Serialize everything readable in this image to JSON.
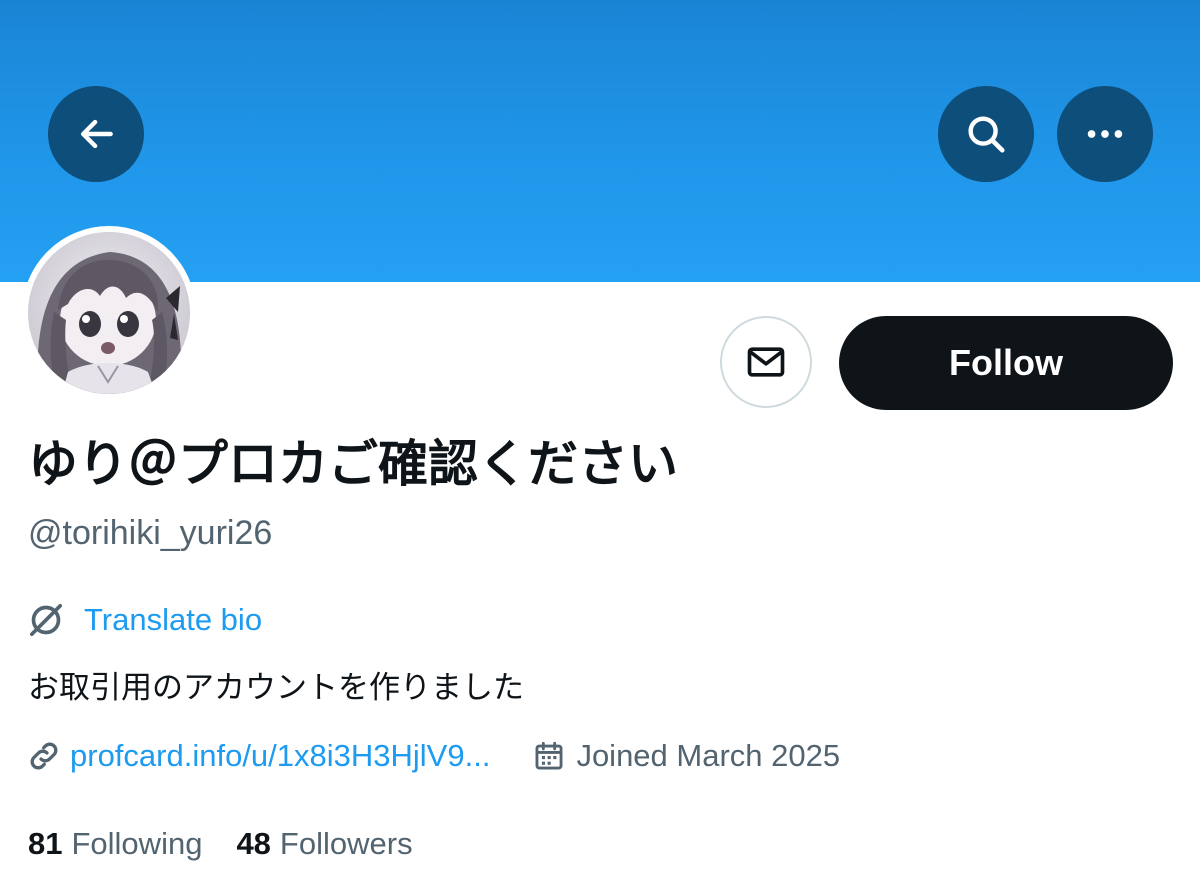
{
  "header": {
    "back_icon": "arrow-left-icon",
    "search_icon": "search-icon",
    "more_icon": "more-horizontal-icon",
    "banner_color": "#1d9bf0",
    "button_color": "#0e4e7a"
  },
  "profile": {
    "display_name": "ゆり＠プロカご確認ください",
    "handle": "@torihiki_yuri26",
    "translate_label": "Translate bio",
    "bio": "お取引用のアカウントを作りました",
    "link": "profcard.info/u/1x8i3H3HjlV9...",
    "joined": "Joined March 2025"
  },
  "actions": {
    "message_icon": "envelope-icon",
    "follow_label": "Follow"
  },
  "stats": {
    "following_count": "81",
    "following_label": "Following",
    "followers_count": "48",
    "followers_label": "Followers"
  },
  "colors": {
    "link": "#1d9bf0",
    "secondary_text": "#536471",
    "primary_text": "#0f1419"
  }
}
